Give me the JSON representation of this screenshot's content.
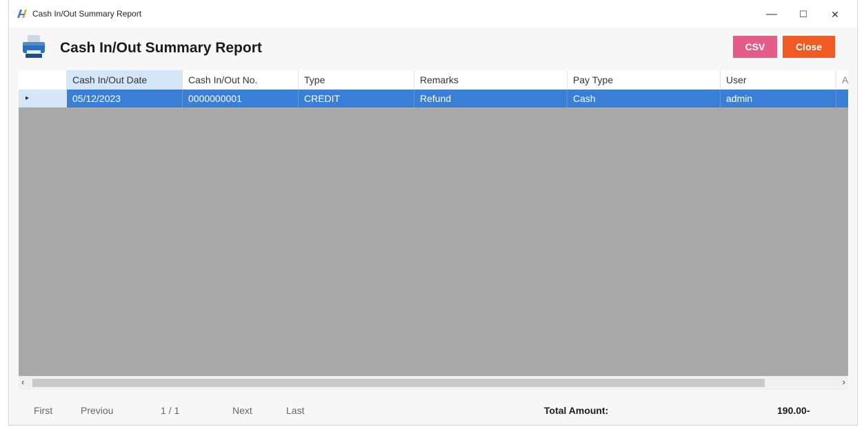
{
  "window": {
    "title": "Cash In/Out Summary Report",
    "minimize": "—",
    "maximize": "☐",
    "close": "✕"
  },
  "header": {
    "title": "Cash In/Out Summary Report",
    "csv_label": "CSV",
    "close_label": "Close"
  },
  "grid": {
    "columns": [
      "Cash In/Out Date",
      "Cash In/Out No.",
      "Type",
      "Remarks",
      "Pay Type",
      "User",
      "A"
    ],
    "rows": [
      {
        "date": "05/12/2023",
        "no": "0000000001",
        "type": "CREDIT",
        "remarks": "Refund",
        "pay_type": "Cash",
        "user": "admin"
      }
    ],
    "row_marker": "▸"
  },
  "scroll": {
    "left": "‹",
    "right": "›"
  },
  "pager": {
    "first": "First",
    "previous": "Previou",
    "page": "1 / 1",
    "next": "Next",
    "last": "Last"
  },
  "totals": {
    "label": "Total Amount:",
    "value": "190.00-"
  },
  "colors": {
    "csv": "#e35c8a",
    "close": "#ef5b22",
    "selection": "#3a7fd6",
    "grid_background": "#a9a9a9"
  }
}
